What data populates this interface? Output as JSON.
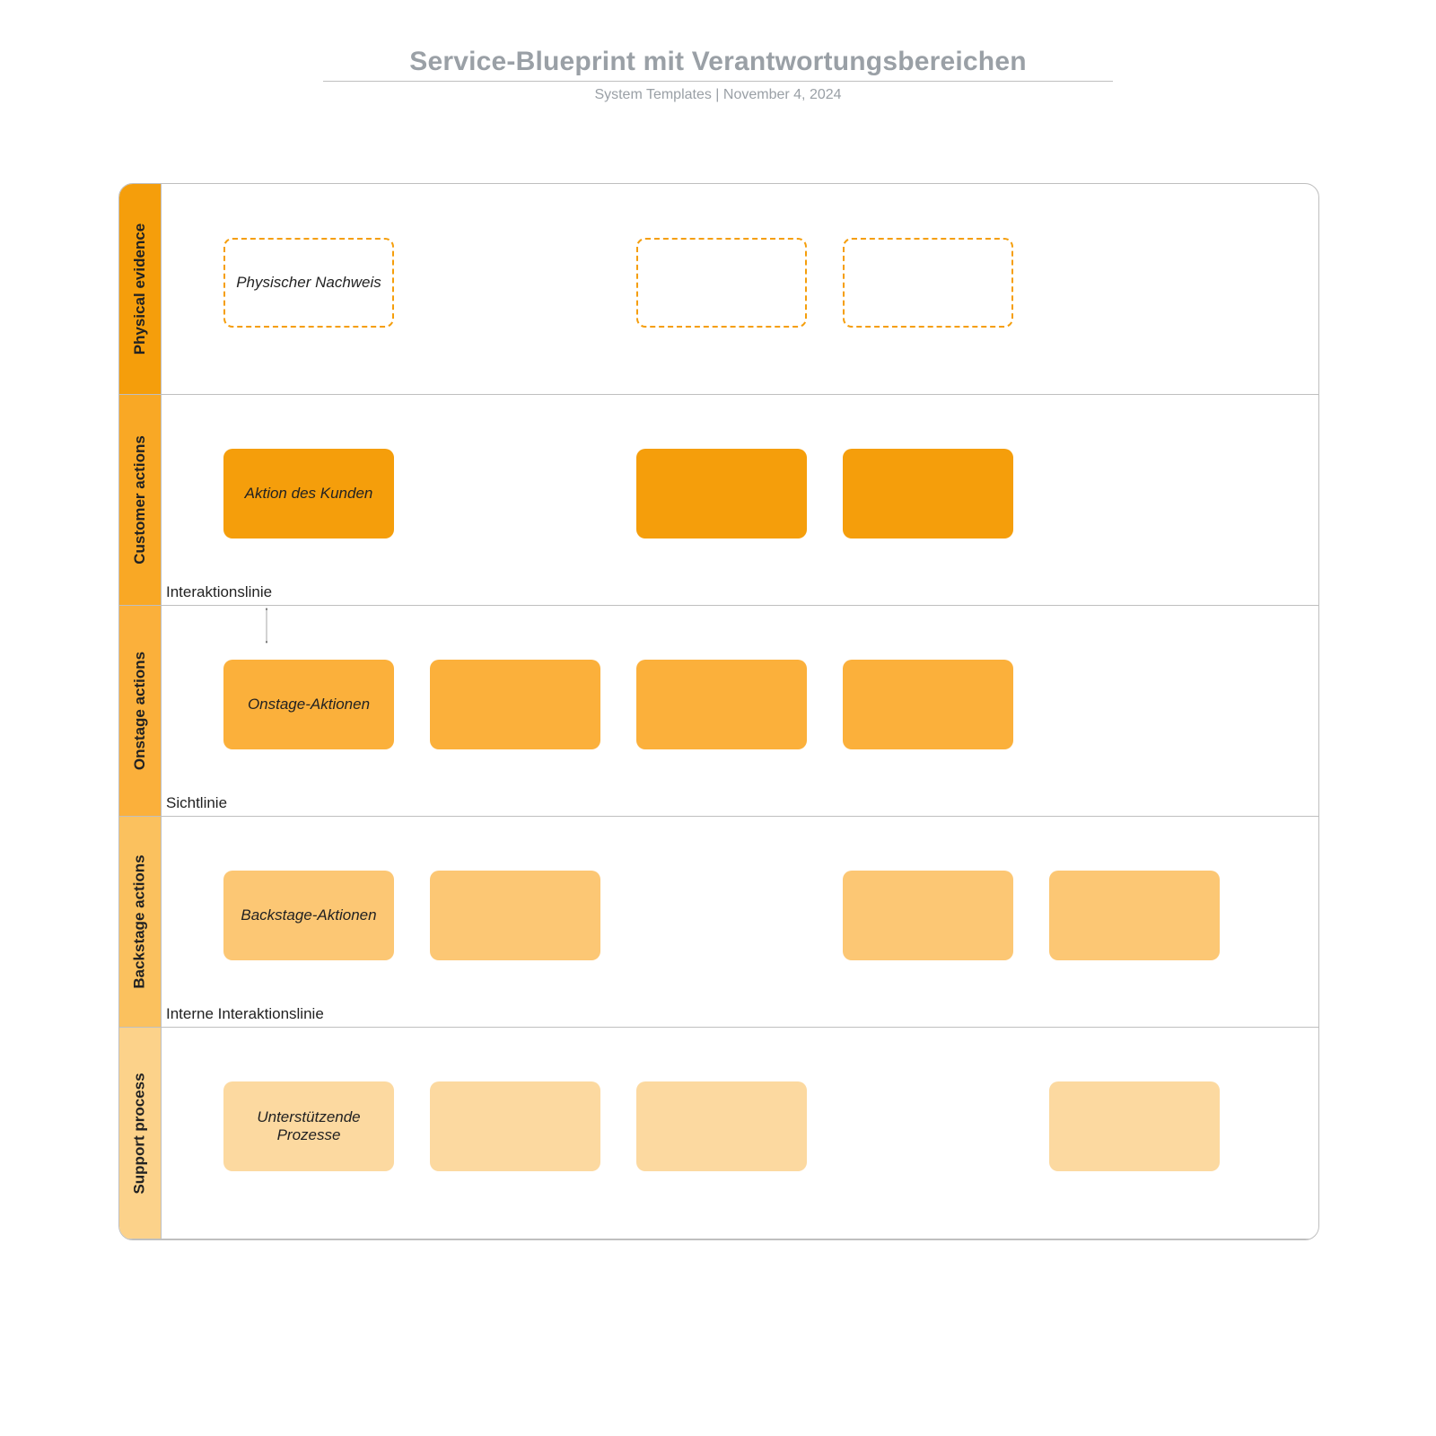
{
  "header": {
    "title": "Service-Blueprint mit Verantwortungsbereichen",
    "subtitle": "System Templates  |  November 4, 2024"
  },
  "lanes": [
    {
      "label": "Physical evidence",
      "divider": ""
    },
    {
      "label": "Customer actions",
      "divider": "Interaktionslinie"
    },
    {
      "label": "Onstage actions",
      "divider": "Sichtlinie"
    },
    {
      "label": "Backstage actions",
      "divider": "Interne Interaktionslinie"
    },
    {
      "label": "Support process",
      "divider": ""
    }
  ],
  "cards": {
    "physical": {
      "c1": "Physischer Nachweis"
    },
    "customer": {
      "c1": "Aktion des Kunden"
    },
    "onstage": {
      "c1": "Onstage-Aktionen"
    },
    "backstage": {
      "c1": "Backstage-Aktionen"
    },
    "support": {
      "c1": "Unterstützende Prozesse"
    }
  }
}
